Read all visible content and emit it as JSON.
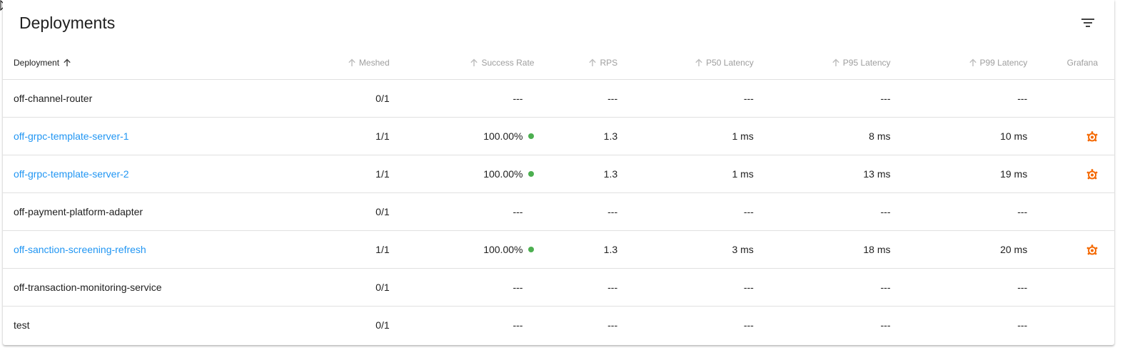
{
  "card": {
    "title": "Deployments",
    "filter_icon": "filter-list-icon"
  },
  "colors": {
    "link": "#2196f3",
    "success_dot": "#4caf50",
    "grafana": "#f46800",
    "header_text": "#9e9e9e"
  },
  "columns": [
    {
      "label": "Deployment",
      "sortable": true,
      "active": true
    },
    {
      "label": "Meshed",
      "sortable": true,
      "active": false
    },
    {
      "label": "Success Rate",
      "sortable": true,
      "active": false
    },
    {
      "label": "RPS",
      "sortable": true,
      "active": false
    },
    {
      "label": "P50 Latency",
      "sortable": true,
      "active": false
    },
    {
      "label": "P95 Latency",
      "sortable": true,
      "active": false
    },
    {
      "label": "P99 Latency",
      "sortable": true,
      "active": false
    },
    {
      "label": "Grafana",
      "sortable": false,
      "active": false
    }
  ],
  "rows": [
    {
      "name": "off-channel-router",
      "link": false,
      "meshed": "0/1",
      "success_rate": "---",
      "success_dot": false,
      "rps": "---",
      "p50": "---",
      "p95": "---",
      "p99": "---",
      "grafana": false
    },
    {
      "name": "off-grpc-template-server-1",
      "link": true,
      "meshed": "1/1",
      "success_rate": "100.00%",
      "success_dot": true,
      "rps": "1.3",
      "p50": "1 ms",
      "p95": "8 ms",
      "p99": "10 ms",
      "grafana": true
    },
    {
      "name": "off-grpc-template-server-2",
      "link": true,
      "meshed": "1/1",
      "success_rate": "100.00%",
      "success_dot": true,
      "rps": "1.3",
      "p50": "1 ms",
      "p95": "13 ms",
      "p99": "19 ms",
      "grafana": true
    },
    {
      "name": "off-payment-platform-adapter",
      "link": false,
      "meshed": "0/1",
      "success_rate": "---",
      "success_dot": false,
      "rps": "---",
      "p50": "---",
      "p95": "---",
      "p99": "---",
      "grafana": false
    },
    {
      "name": "off-sanction-screening-refresh",
      "link": true,
      "meshed": "1/1",
      "success_rate": "100.00%",
      "success_dot": true,
      "rps": "1.3",
      "p50": "3 ms",
      "p95": "18 ms",
      "p99": "20 ms",
      "grafana": true
    },
    {
      "name": "off-transaction-monitoring-service",
      "link": false,
      "meshed": "0/1",
      "success_rate": "---",
      "success_dot": false,
      "rps": "---",
      "p50": "---",
      "p95": "---",
      "p99": "---",
      "grafana": false
    },
    {
      "name": "test",
      "link": false,
      "meshed": "0/1",
      "success_rate": "---",
      "success_dot": false,
      "rps": "---",
      "p50": "---",
      "p95": "---",
      "p99": "---",
      "grafana": false
    }
  ]
}
